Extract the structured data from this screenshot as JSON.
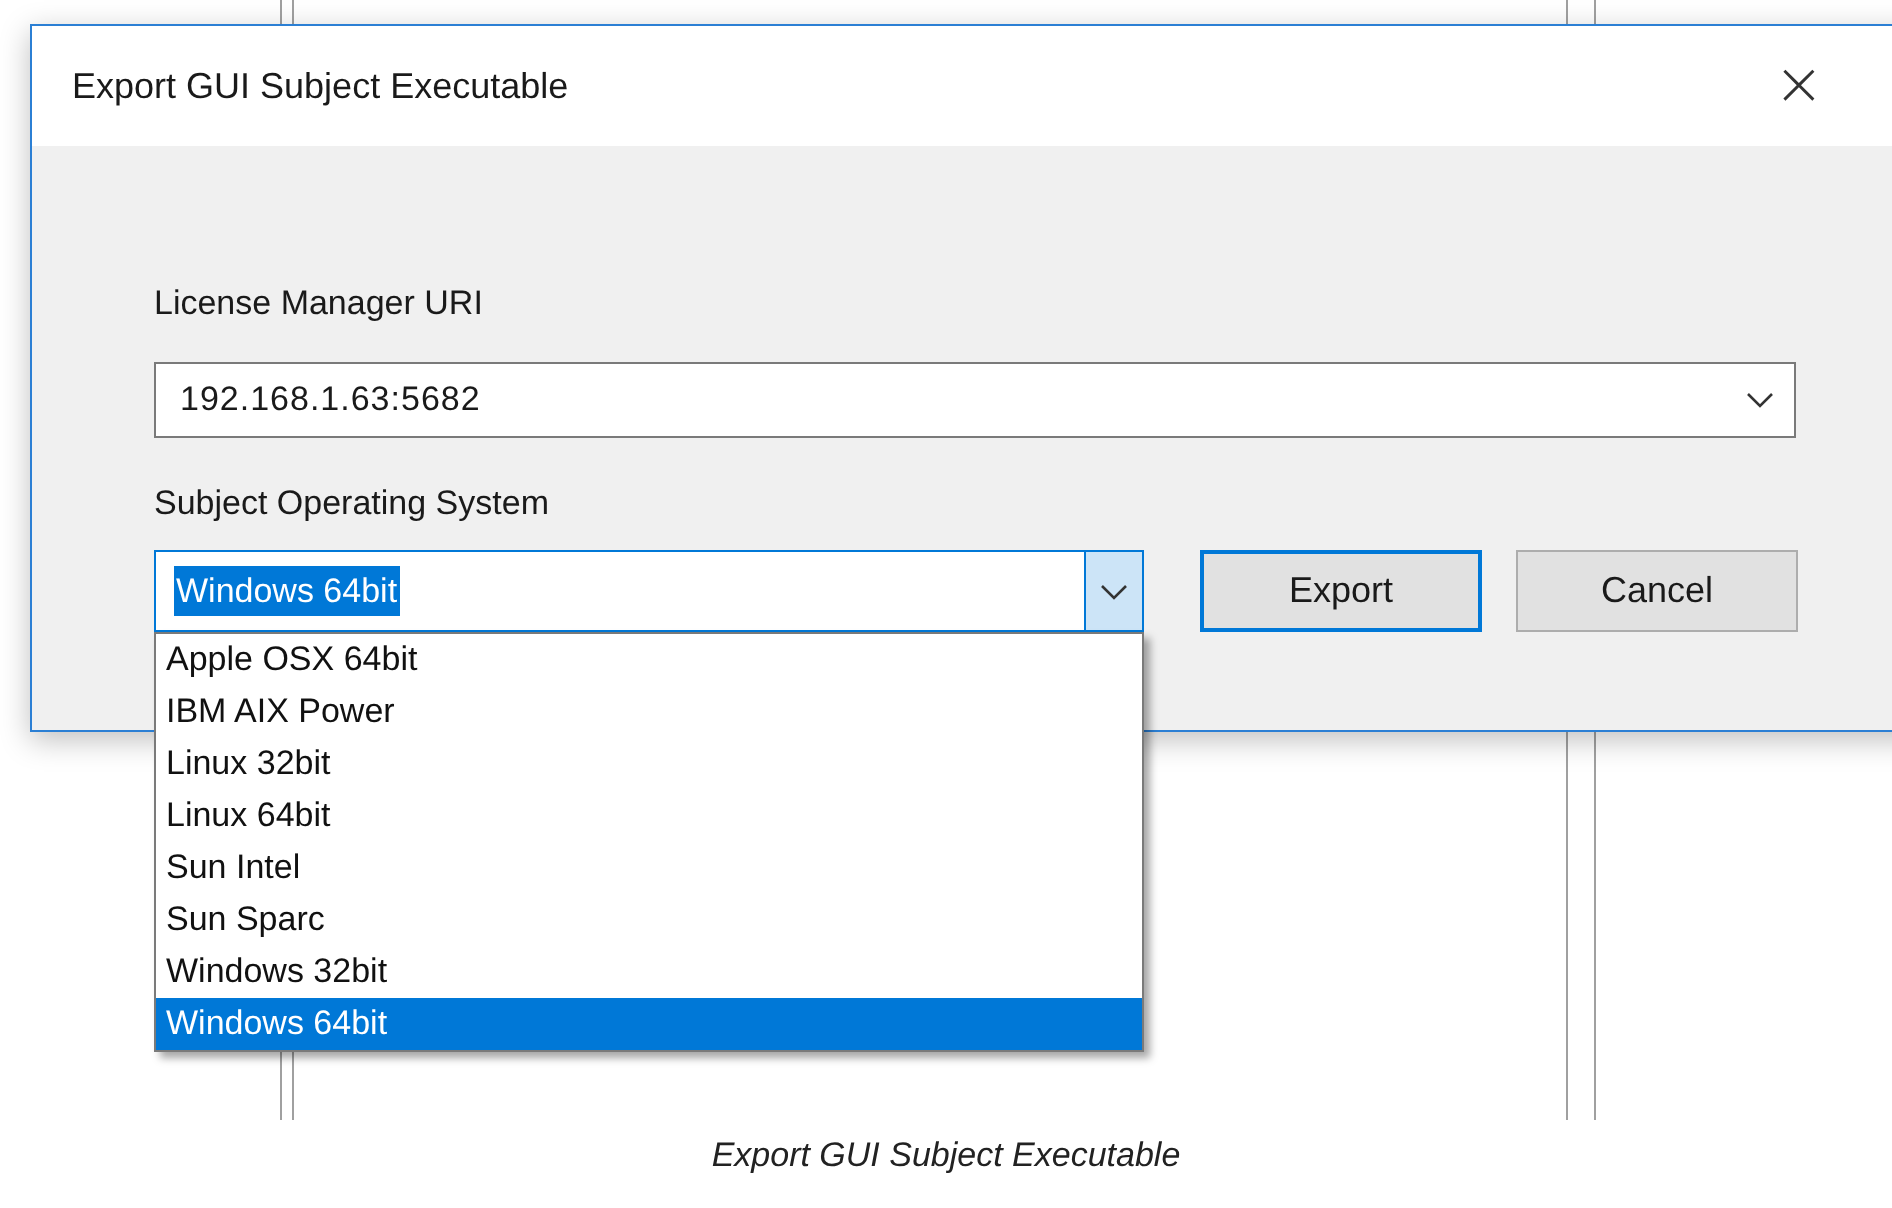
{
  "dialog": {
    "title": "Export GUI Subject Executable",
    "close": "×",
    "license_label": "License Manager URI",
    "license_value": "192.168.1.63:5682",
    "os_label": "Subject Operating System",
    "os_value": "Windows 64bit",
    "os_expanded": true,
    "os_options": [
      {
        "label": "Apple OSX 64bit",
        "selected": false
      },
      {
        "label": "IBM AIX Power",
        "selected": false
      },
      {
        "label": "Linux 32bit",
        "selected": false
      },
      {
        "label": "Linux 64bit",
        "selected": false
      },
      {
        "label": "Sun Intel",
        "selected": false
      },
      {
        "label": "Sun Sparc",
        "selected": false
      },
      {
        "label": "Windows 32bit",
        "selected": false
      },
      {
        "label": "Windows 64bit",
        "selected": true
      }
    ],
    "buttons": [
      {
        "label": "Export",
        "default": true
      },
      {
        "label": "Cancel",
        "default": false
      }
    ]
  },
  "caption": "Export GUI Subject Executable"
}
